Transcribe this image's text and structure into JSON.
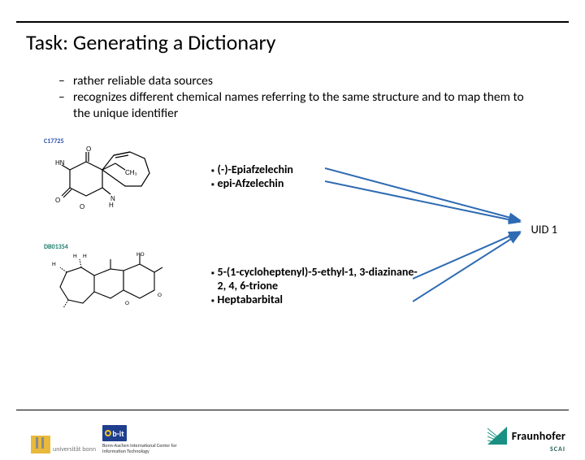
{
  "title": "Task: Generating a Dictionary",
  "bullets": [
    "rather reliable data sources",
    "recognizes different chemical names referring to the same structure and to map them to the unique identifier"
  ],
  "compound_top": {
    "id": "C17725",
    "names": [
      "(-)-Epiafzelechin",
      "epi-Afzelechin"
    ]
  },
  "compound_bottom": {
    "id": "DB01354",
    "names": [
      "5-(1-cycloheptenyl)-5-ethyl-1, 3-diazinane-2, 4, 6-trione",
      "Heptabarbital"
    ]
  },
  "uid_label": "UID 1",
  "footer": {
    "uni": "universität bonn",
    "bit_caption": "Bonn-Aachen International Center for Information Technology",
    "bit_mark": "b-it",
    "fraunhofer": "Fraunhofer",
    "fraun_sub": "SCAI"
  }
}
